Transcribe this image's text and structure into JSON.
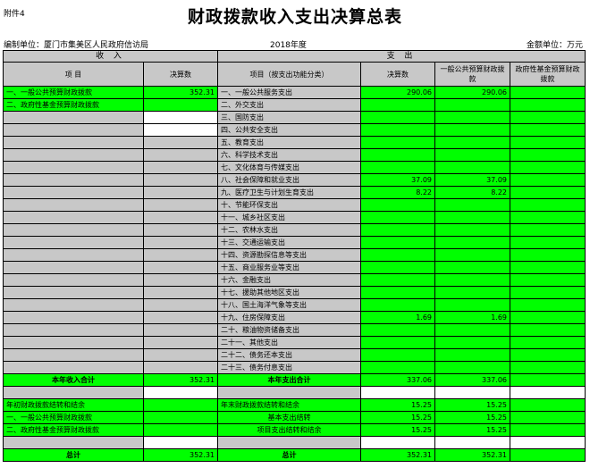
{
  "attachment": "附件4",
  "title": "财政拨款收入支出决算总表",
  "unit_label": "编制单位：厦门市集美区人民政府信访局",
  "year": "2018年度",
  "amount_unit": "金额单位：万元",
  "sections": {
    "income": "收  入",
    "expense": "支  出"
  },
  "headers": {
    "item": "项  目",
    "final_amount": "决算数",
    "func_item": "项目（按支出功能分类）",
    "exp_final": "决算数",
    "general_budget": "一般公共预算财政拨款",
    "gov_fund": "政府性基金预算财政拨款"
  },
  "rows": [
    {
      "in_item": "一、一般公共预算财政拨款",
      "in_val": "352.31",
      "ex_item": "一、一般公共服务支出",
      "ex_total": "290.06",
      "ex_gen": "290.06",
      "ex_fund": ""
    },
    {
      "in_item": "二、政府性基金预算财政拨款",
      "in_val": "",
      "ex_item": "二、外交支出",
      "ex_total": "",
      "ex_gen": "",
      "ex_fund": ""
    },
    {
      "in_item": "",
      "in_val": "",
      "ex_item": "三、国防支出",
      "ex_total": "",
      "ex_gen": "",
      "ex_fund": ""
    },
    {
      "in_item": "",
      "in_val": "",
      "ex_item": "四、公共安全支出",
      "ex_total": "",
      "ex_gen": "",
      "ex_fund": ""
    },
    {
      "in_item": "",
      "in_val": "",
      "ex_item": "五、教育支出",
      "ex_total": "",
      "ex_gen": "",
      "ex_fund": ""
    },
    {
      "in_item": "",
      "in_val": "",
      "ex_item": "六、科学技术支出",
      "ex_total": "",
      "ex_gen": "",
      "ex_fund": ""
    },
    {
      "in_item": "",
      "in_val": "",
      "ex_item": "七、文化体育与传媒支出",
      "ex_total": "",
      "ex_gen": "",
      "ex_fund": ""
    },
    {
      "in_item": "",
      "in_val": "",
      "ex_item": "八、社会保障和就业支出",
      "ex_total": "37.09",
      "ex_gen": "37.09",
      "ex_fund": ""
    },
    {
      "in_item": "",
      "in_val": "",
      "ex_item": "九、医疗卫生与计划生育支出",
      "ex_total": "8.22",
      "ex_gen": "8.22",
      "ex_fund": ""
    },
    {
      "in_item": "",
      "in_val": "",
      "ex_item": "十、节能环保支出",
      "ex_total": "",
      "ex_gen": "",
      "ex_fund": ""
    },
    {
      "in_item": "",
      "in_val": "",
      "ex_item": "十一、城乡社区支出",
      "ex_total": "",
      "ex_gen": "",
      "ex_fund": ""
    },
    {
      "in_item": "",
      "in_val": "",
      "ex_item": "十二、农林水支出",
      "ex_total": "",
      "ex_gen": "",
      "ex_fund": ""
    },
    {
      "in_item": "",
      "in_val": "",
      "ex_item": "十三、交通运输支出",
      "ex_total": "",
      "ex_gen": "",
      "ex_fund": ""
    },
    {
      "in_item": "",
      "in_val": "",
      "ex_item": "十四、资源勘探信息等支出",
      "ex_total": "",
      "ex_gen": "",
      "ex_fund": ""
    },
    {
      "in_item": "",
      "in_val": "",
      "ex_item": "十五、商业服务业等支出",
      "ex_total": "",
      "ex_gen": "",
      "ex_fund": ""
    },
    {
      "in_item": "",
      "in_val": "",
      "ex_item": "十六、金融支出",
      "ex_total": "",
      "ex_gen": "",
      "ex_fund": ""
    },
    {
      "in_item": "",
      "in_val": "",
      "ex_item": "十七、援助其他地区支出",
      "ex_total": "",
      "ex_gen": "",
      "ex_fund": ""
    },
    {
      "in_item": "",
      "in_val": "",
      "ex_item": "十八、国土海洋气象等支出",
      "ex_total": "",
      "ex_gen": "",
      "ex_fund": ""
    },
    {
      "in_item": "",
      "in_val": "",
      "ex_item": "十九、住房保障支出",
      "ex_total": "1.69",
      "ex_gen": "1.69",
      "ex_fund": ""
    },
    {
      "in_item": "",
      "in_val": "",
      "ex_item": "二十、粮油物资储备支出",
      "ex_total": "",
      "ex_gen": "",
      "ex_fund": ""
    },
    {
      "in_item": "",
      "in_val": "",
      "ex_item": "二十一、其他支出",
      "ex_total": "",
      "ex_gen": "",
      "ex_fund": ""
    },
    {
      "in_item": "",
      "in_val": "",
      "ex_item": "二十二、债务还本支出",
      "ex_total": "",
      "ex_gen": "",
      "ex_fund": ""
    },
    {
      "in_item": "",
      "in_val": "",
      "ex_item": "二十三、债务付息支出",
      "ex_total": "",
      "ex_gen": "",
      "ex_fund": ""
    }
  ],
  "totals_row": {
    "income_label": "本年收入合计",
    "income_val": "352.31",
    "expense_label": "本年支出合计",
    "ex_total": "337.06",
    "ex_gen": "337.06",
    "ex_fund": ""
  },
  "carry_rows": [
    {
      "in_item": "年初财政拨款结转和结余",
      "in_val": "",
      "ex_item": "年末财政拨款结转和结余",
      "ex_total": "15.25",
      "ex_gen": "15.25",
      "ex_fund": ""
    },
    {
      "in_item": "一、一般公共预算财政拨款",
      "in_val": "",
      "ex_item": "基本支出结转",
      "ex_total": "15.25",
      "ex_gen": "15.25",
      "ex_fund": ""
    },
    {
      "in_item": "二、政府性基金预算财政拨款",
      "in_val": "",
      "ex_item": "项目支出结转和结余",
      "ex_total": "15.25",
      "ex_gen": "15.25",
      "ex_fund": ""
    }
  ],
  "grand_total": {
    "income_label": "总计",
    "income_val": "352.31",
    "expense_label": "总计",
    "ex_total": "352.31",
    "ex_gen": "352.31",
    "ex_fund": ""
  },
  "colors": {
    "green": "#00ff00",
    "gray": "#c8c8c8",
    "white": "#ffffff"
  }
}
